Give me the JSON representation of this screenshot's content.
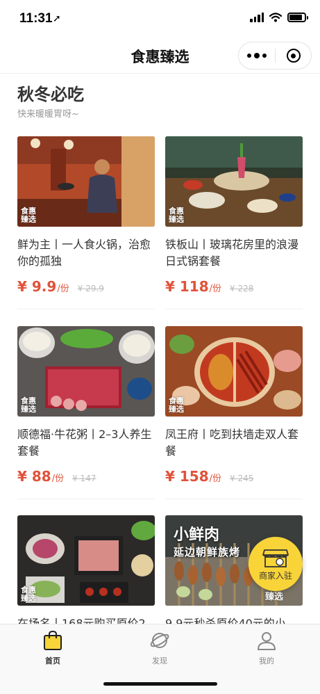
{
  "status_bar": {
    "time": "11:31",
    "location_icon": "location-arrow-icon",
    "battery_level": 0.85
  },
  "nav": {
    "title": "食惠臻选",
    "more_icon": "more-dots-icon",
    "close_icon": "close-target-icon"
  },
  "section": {
    "title": "秋冬必吃",
    "subtitle": "快来暖暖胃呀~"
  },
  "watermark": {
    "line1": "食惠",
    "line2": "臻选"
  },
  "products": [
    {
      "title": "鲜为主丨一人食火锅，治愈你的孤独",
      "price": "¥ 9.9",
      "unit": "/份",
      "original": "¥ 29.9"
    },
    {
      "title": "铁板山丨玻璃花房里的浪漫日式锅套餐",
      "price": "¥ 118",
      "unit": "/份",
      "original": "¥ 228"
    },
    {
      "title": "顺德福·牛花粥丨2–3人养生套餐",
      "price": "¥ 88",
      "unit": "/份",
      "original": "¥ 147"
    },
    {
      "title": "凤王府丨吃到扶墙走双人套餐",
      "price": "¥ 158",
      "unit": "/份",
      "original": "¥ 245"
    },
    {
      "title": "在场名丨168元购买原价2",
      "price": "",
      "unit": "",
      "original": ""
    },
    {
      "title": "9.9元秒杀原价40元的小",
      "price": "",
      "unit": "",
      "original": ""
    }
  ],
  "banner_text": {
    "line1": "小鲜肉",
    "line2": "延边朝鲜族烤"
  },
  "fab": {
    "label": "商家入驻",
    "icon": "shop-icon"
  },
  "tabbar": {
    "items": [
      {
        "label": "首页",
        "icon": "shopping-bag-icon",
        "active": true
      },
      {
        "label": "发现",
        "icon": "planet-icon",
        "active": false
      },
      {
        "label": "我的",
        "icon": "user-icon",
        "active": false
      }
    ]
  },
  "colors": {
    "accent": "#e0523a",
    "fab": "#f8d439",
    "active_tab_icon": "#f8d439"
  }
}
